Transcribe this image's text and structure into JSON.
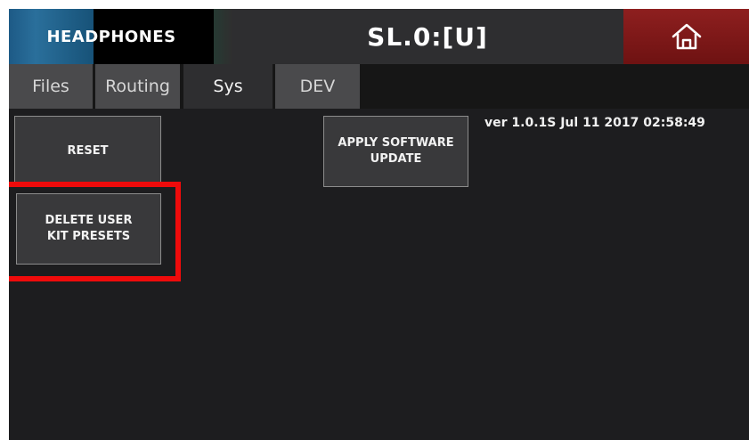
{
  "header": {
    "badge_label": "HEADPHONES",
    "kit_title": "SL.0:[U]",
    "home_icon": "home-icon"
  },
  "tabs": [
    {
      "label": "Files",
      "active": false
    },
    {
      "label": "Routing",
      "active": false
    },
    {
      "label": "Sys",
      "active": true
    },
    {
      "label": "DEV",
      "active": false
    }
  ],
  "sys": {
    "reset_label": "RESET",
    "delete_presets_label": "DELETE USER\nKIT PRESETS",
    "apply_update_label": "APPLY SOFTWARE\nUPDATE",
    "version_text": "ver 1.0.1S Jul 11 2017 02:58:49"
  },
  "colors": {
    "highlight": "#ef0b0b",
    "home_button": "#8e1f1f",
    "badge_blue": "#1d5a86"
  }
}
